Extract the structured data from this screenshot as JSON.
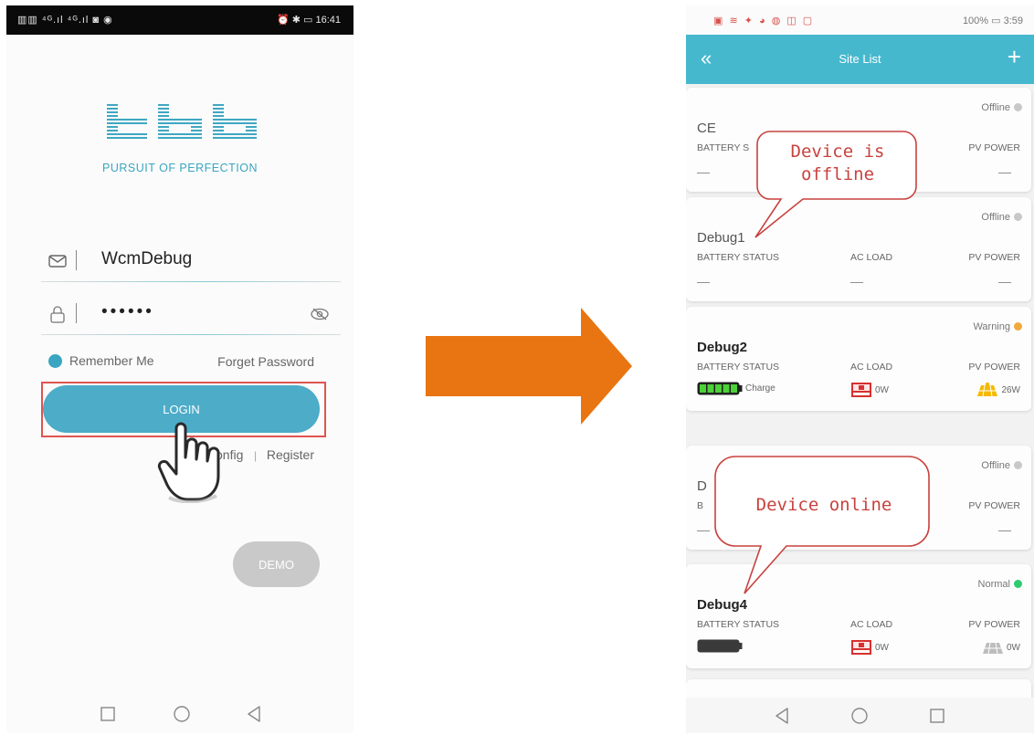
{
  "login_screen": {
    "status_bar": {
      "left": "▥▥ ⁴ᴳ.ıl ⁴ᴳ.ıl ◙ ◉",
      "right": "⏰ ✱ ▭ 16:41"
    },
    "tagline": "PURSUIT OF PERFECTION",
    "username": {
      "icon": "mail-icon",
      "value": "WcmDebug"
    },
    "password": {
      "icon": "lock-icon",
      "masked_value": "••••••",
      "toggle_icon": "eye-off-icon"
    },
    "remember_me": "Remember Me",
    "forget_password": "Forget Password",
    "login_button": "LOGIN",
    "config_link": "onfig",
    "divider": "|",
    "register_link": "Register",
    "demo_button": "DEMO",
    "nav": [
      "square-icon",
      "circle-icon",
      "triangle-back-icon"
    ],
    "accent_color": "#4dacc8",
    "highlight_color": "#e0544f"
  },
  "transition_arrow": {
    "color": "#e87511"
  },
  "site_list_screen": {
    "status_bar": {
      "left": "▣ ≋ ✦ ◕ ◍ ◫ ▢",
      "right": "100% ▭ 3:59"
    },
    "header": {
      "back": "«",
      "title": "Site List",
      "add": "+"
    },
    "header_color": "#46b8ce",
    "col_labels": {
      "battery": "BATTERY STATUS",
      "ac": "AC LOAD",
      "pv": "PV POWER"
    },
    "sites": [
      {
        "name": "CE",
        "status": "Offline",
        "status_color": "#c8c8c8",
        "battery_label": "BATTERY S",
        "ac_label": "",
        "pv_label": "PV POWER",
        "battery": "—",
        "ac": "",
        "pv": "—"
      },
      {
        "name": "Debug1",
        "status": "Offline",
        "status_color": "#c8c8c8",
        "battery_label": "BATTERY STATUS",
        "ac_label": "AC LOAD",
        "pv_label": "PV POWER",
        "battery": "—",
        "ac": "—",
        "pv": "—"
      },
      {
        "name": "Debug2",
        "status": "Warning",
        "status_color": "#f2a93b",
        "battery_label": "BATTERY STATUS",
        "ac_label": "AC LOAD",
        "pv_label": "PV POWER",
        "battery": "Charge",
        "ac": "0W",
        "pv": "26W"
      },
      {
        "name": "D",
        "status": "Offline",
        "status_color": "#c8c8c8",
        "battery_label": "B",
        "ac_label": "",
        "pv_label": "PV POWER",
        "battery": "—",
        "ac": "",
        "pv": "—"
      },
      {
        "name": "Debug4",
        "status": "Normal",
        "status_color": "#2ecc71",
        "battery_label": "BATTERY STATUS",
        "ac_label": "AC LOAD",
        "pv_label": "PV POWER",
        "battery": "",
        "ac": "0W",
        "pv": "0W"
      }
    ],
    "callouts": {
      "offline": [
        "Device is",
        "offline"
      ],
      "online": "Device online"
    },
    "nav": [
      "triangle-back-icon",
      "circle-icon",
      "square-icon"
    ]
  }
}
